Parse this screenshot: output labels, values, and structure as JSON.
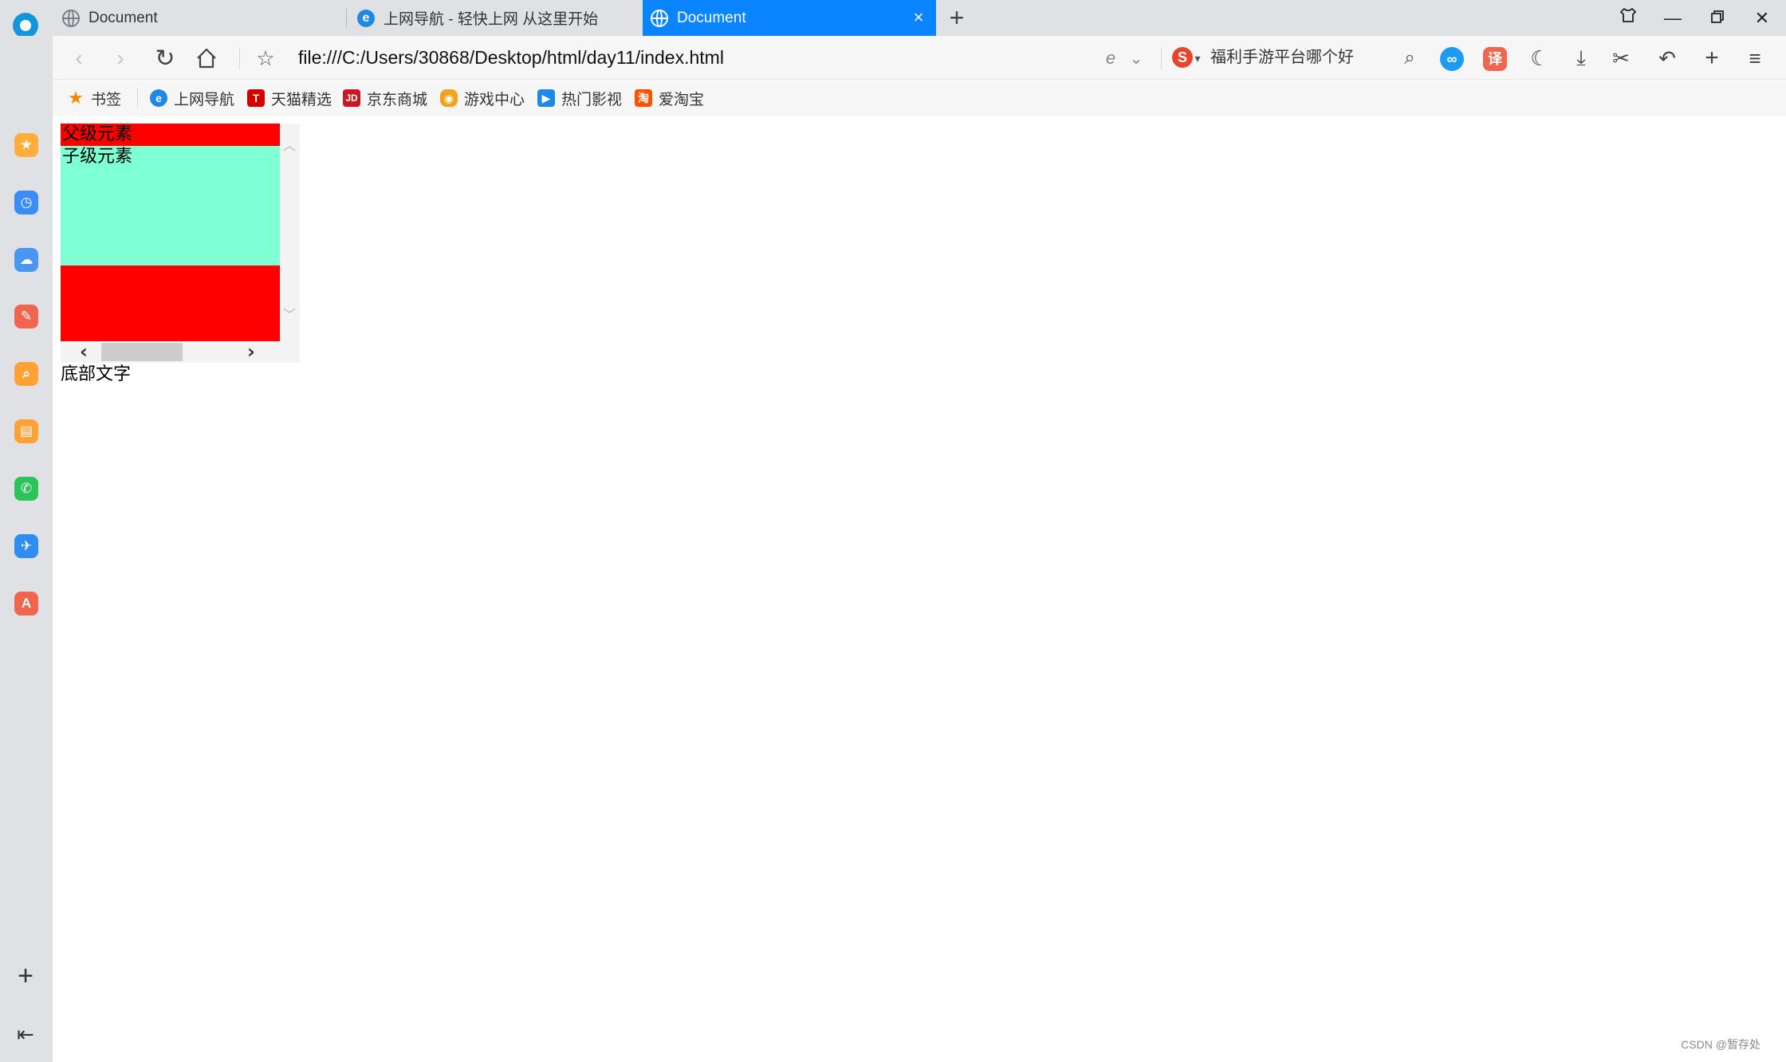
{
  "tabs": [
    {
      "title": "Document",
      "icon": "globe-icon",
      "active": false
    },
    {
      "title": "上网导航 - 轻快上网 从这里开始",
      "icon": "ie-icon",
      "active": false
    },
    {
      "title": "Document",
      "icon": "globe-icon",
      "active": true
    }
  ],
  "toolbar": {
    "url": "file:///C:/Users/30868/Desktop/html/day11/index.html",
    "search_text": "福利手游平台哪个好",
    "translate_label": "译"
  },
  "bookmarks": [
    {
      "label": "书签",
      "icon": "star-icon",
      "color": "#f08a00"
    },
    {
      "label": "上网导航",
      "icon": "ie-icon",
      "color": "#1e88e5"
    },
    {
      "label": "天猫精选",
      "icon": "tmall-icon",
      "color": "#d40000"
    },
    {
      "label": "京东商城",
      "icon": "jd-icon",
      "color": "#c81623"
    },
    {
      "label": "游戏中心",
      "icon": "gamepad-icon",
      "color": "#f4a21a"
    },
    {
      "label": "热门影视",
      "icon": "play-icon",
      "color": "#1e88e5"
    },
    {
      "label": "爱淘宝",
      "icon": "taobao-icon",
      "color": "#ff5000"
    }
  ],
  "page": {
    "parent_label": "父级元素",
    "child_label": "子级元素",
    "bottom_text": "底部文字",
    "parent_color": "#ff0000",
    "child_color": "#7fffd4"
  },
  "watermark": "CSDN @暂存处"
}
